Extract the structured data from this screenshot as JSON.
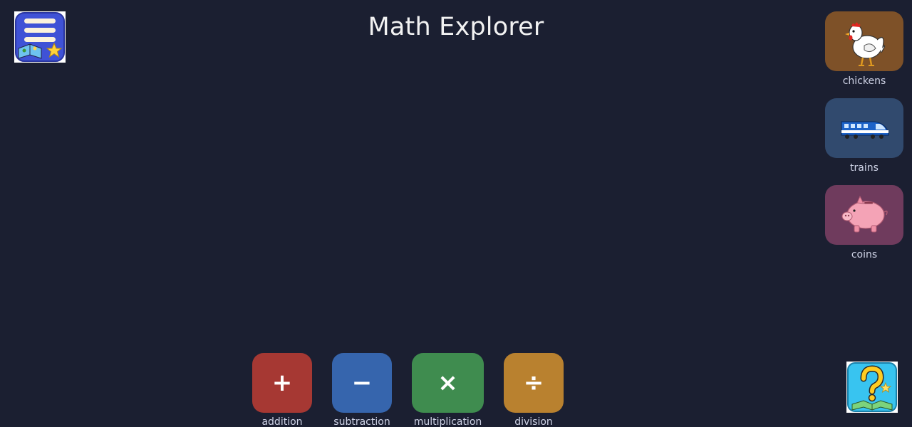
{
  "header": {
    "title": "Math Explorer"
  },
  "menu": {
    "icon": "menu-book-icon"
  },
  "themes": [
    {
      "label": "chickens",
      "icon": "chicken-icon",
      "color": "#7e5128"
    },
    {
      "label": "trains",
      "icon": "train-icon",
      "color": "#314a6e"
    },
    {
      "label": "coins",
      "icon": "piggy-bank-icon",
      "color": "#6f3b5d"
    }
  ],
  "operations": [
    {
      "symbol": "+",
      "label": "addition",
      "color": "#a63833"
    },
    {
      "symbol": "−",
      "label": "subtraction",
      "color": "#3665ad"
    },
    {
      "symbol": "×",
      "label": "multiplication",
      "color": "#3f8c4f"
    },
    {
      "symbol": "÷",
      "label": "division",
      "color": "#b9812f"
    }
  ],
  "help": {
    "icon": "help-question-icon"
  }
}
